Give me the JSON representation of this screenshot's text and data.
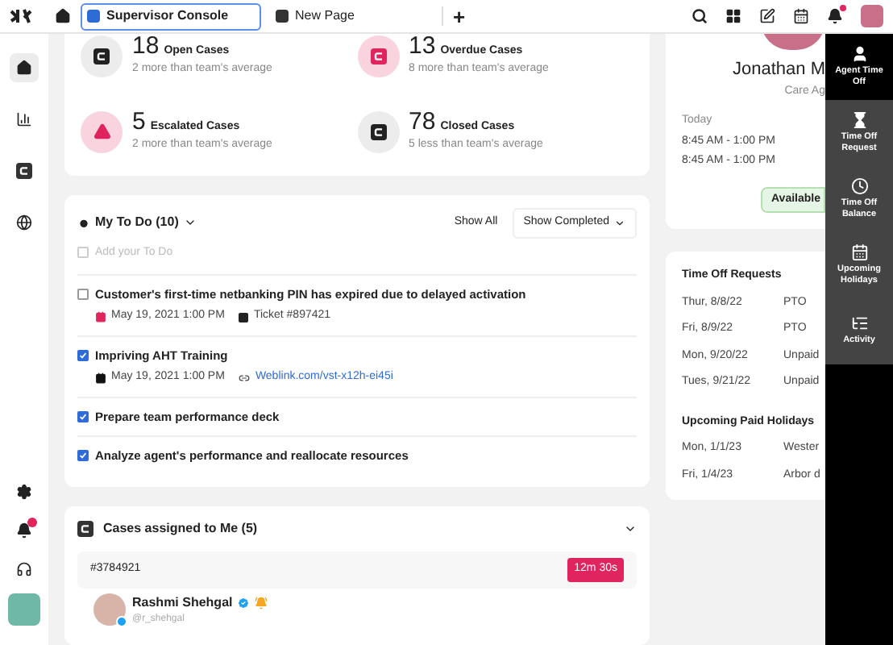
{
  "top_bar": {
    "tabs": [
      {
        "label": "Supervisor Console",
        "selected": true
      },
      {
        "label": "New Page",
        "selected": false
      }
    ],
    "new_tab": "+"
  },
  "sidebar": {
    "items": [
      {
        "kind": "home",
        "selected": true
      },
      {
        "kind": "chart",
        "selected": false
      },
      {
        "kind": "case",
        "selected": false
      },
      {
        "kind": "globe",
        "selected": false
      }
    ]
  },
  "stats": [
    {
      "value": "18",
      "label": "Open Cases",
      "note": "2 more than team's average",
      "kind": "case",
      "highlight": false
    },
    {
      "value": "13",
      "label": "Overdue Cases",
      "note": "8 more than team's average",
      "kind": "case",
      "highlight": true
    },
    {
      "value": "5",
      "label": "Escalated Cases",
      "note": "2 more than team's average",
      "kind": "alert",
      "highlight": true
    },
    {
      "value": "78",
      "label": "Closed Cases",
      "note": "5 less than team's average",
      "kind": "case",
      "highlight": false
    }
  ],
  "todo": {
    "title": "My To Do (10)",
    "show_all": "Show All",
    "filter": "Show Completed",
    "add_item": {
      "placeholder": "Add your To Do",
      "checked": false
    },
    "items": [
      {
        "text": "Customer's first-time netbanking PIN has expired due to delayed activation",
        "checked": false,
        "date": {
          "text": "May 19, 2021 1:00 PM",
          "color": "#e0245e"
        },
        "ref": {
          "kind": "ticket",
          "text": "Ticket #897421"
        }
      },
      {
        "text": "Impriving AHT Training",
        "checked": true,
        "date": {
          "text": "May 19, 2021 1:00 PM",
          "color": "#111111"
        },
        "ref": {
          "kind": "link",
          "text": "Weblink.com/vst-x12h-ei45i"
        }
      },
      {
        "text": "Prepare team performance deck",
        "checked": true
      },
      {
        "text": "Analyze agent's performance and reallocate resources",
        "checked": true
      }
    ]
  },
  "cases": {
    "title": "Cases assigned to Me (5)",
    "case": {
      "id": "#3784921",
      "timer": "12m 30s",
      "name": "Rashmi Shehgal",
      "handle": "@r_shehgal",
      "verified": true
    }
  },
  "agent": {
    "name": "Jonathan M",
    "role": "Care Ag",
    "schedule_label": "Today",
    "times": [
      "8:45 AM - 1:00 PM",
      "8:45 AM - 1:00 PM"
    ],
    "status": "Available"
  },
  "time_off": {
    "title": "Time Off Requests",
    "rows": [
      {
        "date": "Thur, 8/8/22",
        "type": "PTO"
      },
      {
        "date": "Fri, 8/9/22",
        "type": "PTO"
      },
      {
        "date": "Mon, 9/20/22",
        "type": "Unpaid"
      },
      {
        "date": "Tues, 9/21/22",
        "type": "Unpaid"
      }
    ],
    "holidays_title": "Upcoming Paid Holidays",
    "holidays": [
      {
        "date": "Mon, 1/1/23",
        "type": "Wester"
      },
      {
        "date": "Fri, 1/4/23",
        "type": "Arbor d"
      }
    ]
  },
  "side_panel": {
    "items": [
      {
        "label": "Agent Time Off",
        "kind": "person",
        "selected": true
      },
      {
        "label": "Time Off Request",
        "kind": "hourglass",
        "selected": false
      },
      {
        "label": "Time Off Balance",
        "kind": "clock",
        "selected": false
      },
      {
        "label": "Upcoming Holidays",
        "kind": "calendar",
        "selected": false
      },
      {
        "label": "Activity",
        "kind": "activity",
        "selected": false
      }
    ]
  }
}
